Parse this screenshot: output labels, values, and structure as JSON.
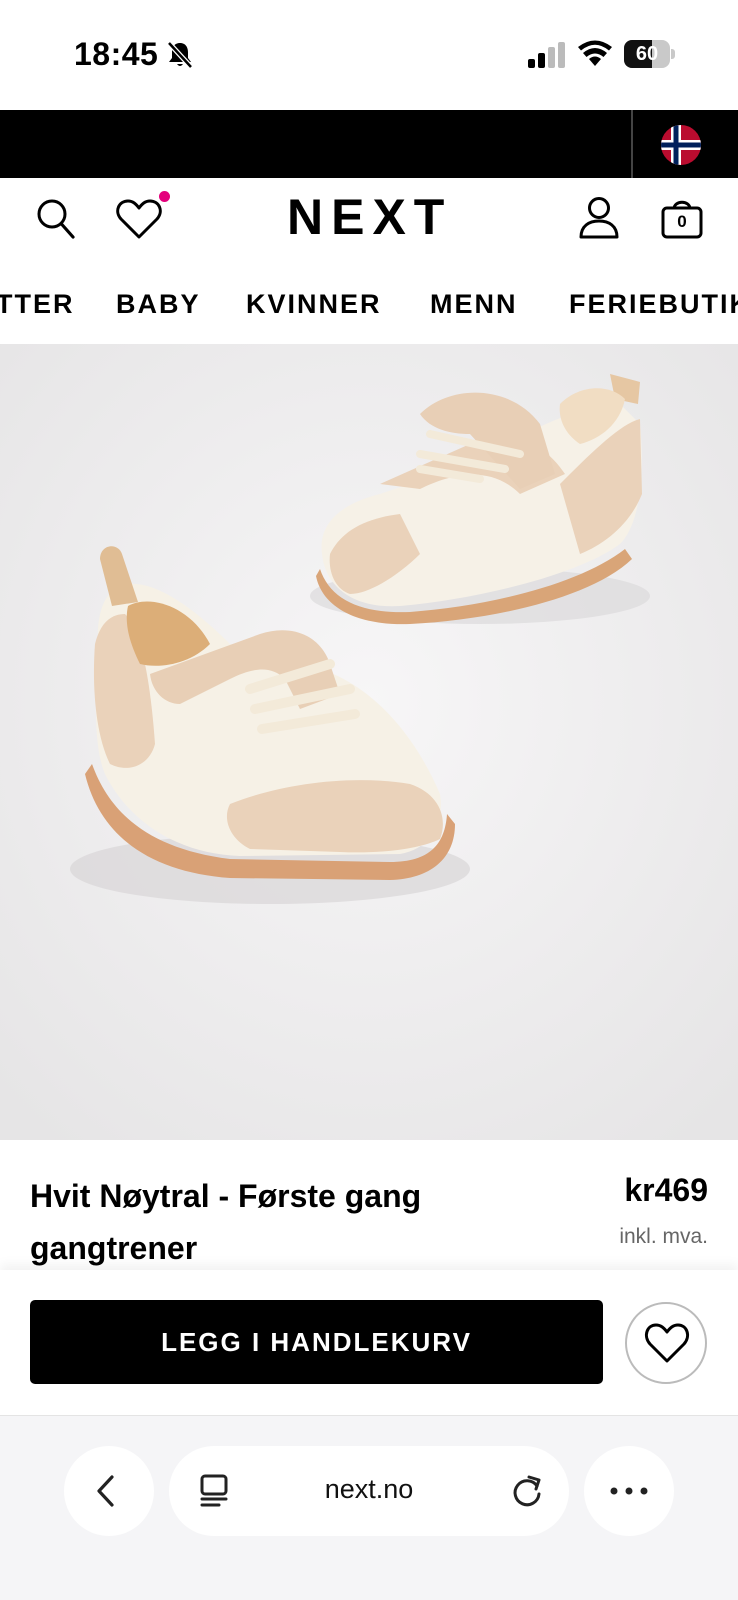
{
  "status_bar": {
    "time": "18:45",
    "battery_percent": "60",
    "battery_level": 0.6
  },
  "header": {
    "logo": "NEXT",
    "bag_count": "0",
    "wishlist_has_items": true
  },
  "categories": [
    {
      "label": "TTER"
    },
    {
      "label": "BABY"
    },
    {
      "label": "KVINNER"
    },
    {
      "label": "MENN"
    },
    {
      "label": "FERIEBUTIK"
    }
  ],
  "carousel": {
    "total": 5,
    "active_index": 0
  },
  "product": {
    "title": "Hvit Nøytral - Første gang gangtrener",
    "price": "kr469",
    "vat_note": "inkl. mva."
  },
  "actions": {
    "add_to_bag_label": "LEGG I HANDLEKURV"
  },
  "browser": {
    "url": "next.no"
  },
  "colors": {
    "brand_black": "#000000",
    "wishlist_dot": "#e4007c",
    "image_background": "#eeedee"
  }
}
